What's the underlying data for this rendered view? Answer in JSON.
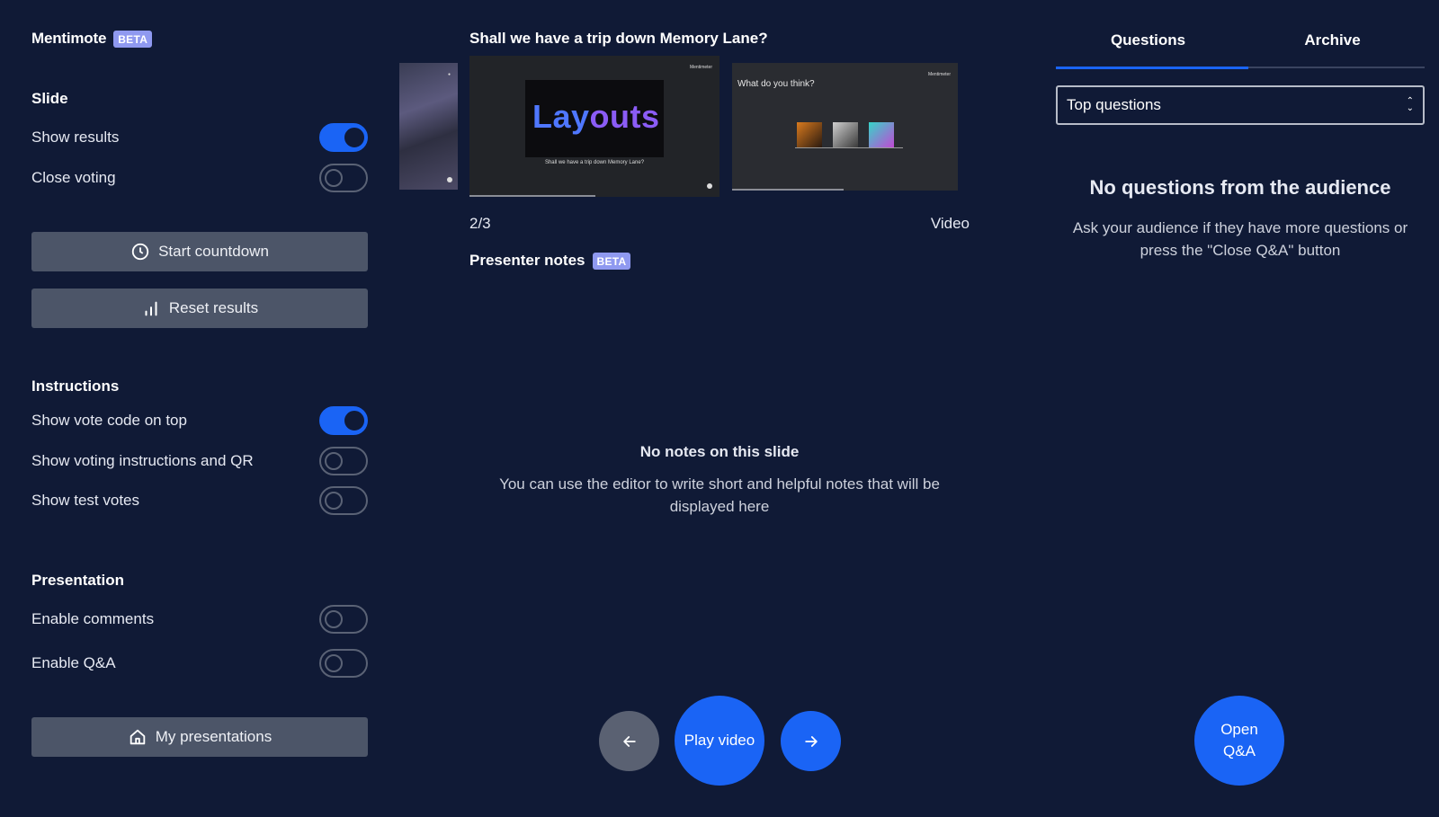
{
  "app": {
    "name": "Mentimote",
    "badge": "BETA"
  },
  "left": {
    "slide": {
      "title": "Slide",
      "show_results": {
        "label": "Show results",
        "on": true
      },
      "close_voting": {
        "label": "Close voting",
        "on": false
      }
    },
    "start_countdown": {
      "label": "Start countdown",
      "icon": "clock-icon"
    },
    "reset_results": {
      "label": "Reset results",
      "icon": "bar-chart-icon"
    },
    "instructions": {
      "title": "Instructions",
      "show_vote_code": {
        "label": "Show vote code on top",
        "on": true
      },
      "show_voting_instructions": {
        "label": "Show voting instructions and QR",
        "on": false
      },
      "show_test_votes": {
        "label": "Show test votes",
        "on": false
      }
    },
    "presentation": {
      "title": "Presentation",
      "enable_comments": {
        "label": "Enable comments",
        "on": false
      },
      "enable_qa": {
        "label": "Enable Q&A",
        "on": false
      }
    },
    "my_presentations": {
      "label": "My presentations",
      "icon": "home-icon"
    }
  },
  "middle": {
    "slide_title": "Shall we have a trip down Memory Lane?",
    "current_thumb": {
      "word_a": "Lay",
      "word_b": "outs",
      "caption": "Shall we have a trip down Memory Lane?",
      "logo": "Mentimeter"
    },
    "next_thumb": {
      "title": "What do you think?",
      "logo": "Mentimeter"
    },
    "counter": "2/3",
    "slide_type": "Video",
    "notes": {
      "title": "Presenter notes",
      "badge": "BETA",
      "empty_title": "No notes on this slide",
      "empty_text": "You can use the editor to write short and helpful notes that will be displayed here"
    },
    "nav": {
      "play_label": "Play video"
    }
  },
  "right": {
    "tabs": [
      {
        "label": "Questions",
        "active": true
      },
      {
        "label": "Archive",
        "active": false
      }
    ],
    "sort": {
      "selected": "Top questions"
    },
    "empty_title": "No questions from the audience",
    "empty_text": "Ask your audience if they have more questions or press the \"Close Q&A\" button",
    "open_qa": "Open Q&A"
  },
  "colors": {
    "background": "#101a36",
    "accent": "#1a64f5",
    "button": "#4c5568",
    "badge": "#8f99f0"
  }
}
